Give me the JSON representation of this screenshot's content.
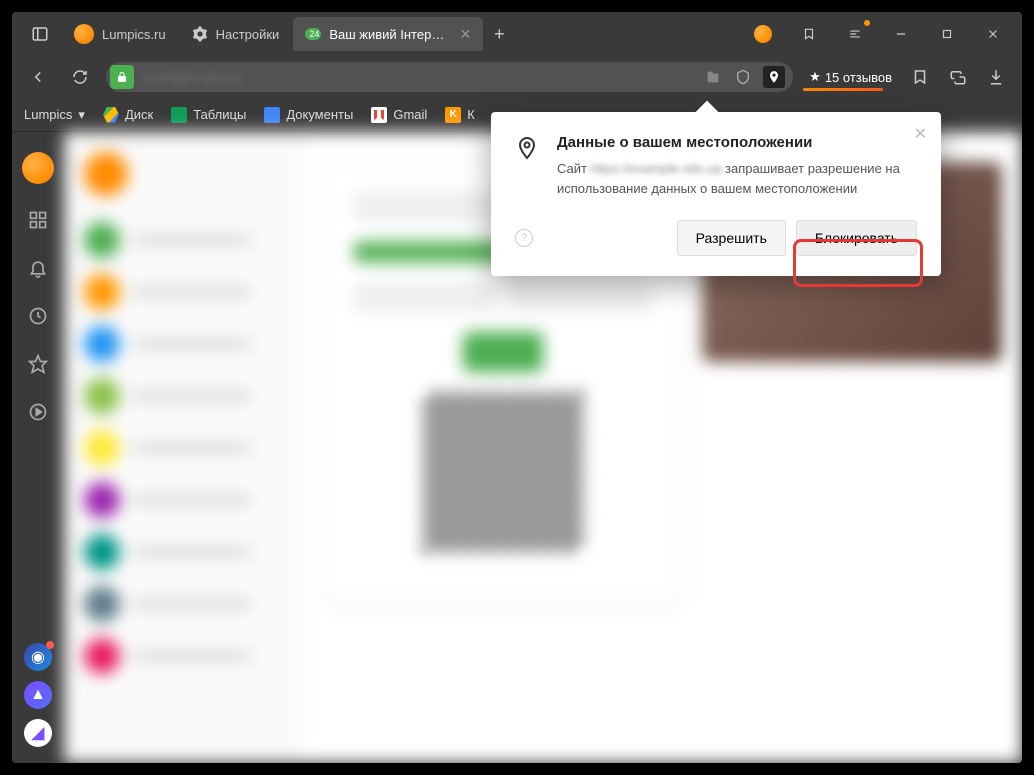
{
  "tabs": [
    {
      "title": "Lumpics.ru",
      "icon": "orange"
    },
    {
      "title": "Настройки",
      "icon": "gear"
    },
    {
      "title": "Ваш живий Інтернет-б",
      "icon": "badge",
      "badge": "24",
      "active": true
    }
  ],
  "addr": {
    "reviews_label": "15 отзывов"
  },
  "bookmarks": {
    "menu": "Lumpics",
    "items": [
      {
        "label": "Диск",
        "icon": "drive"
      },
      {
        "label": "Таблицы",
        "icon": "sheets"
      },
      {
        "label": "Документы",
        "icon": "docs"
      },
      {
        "label": "Gmail",
        "icon": "gmail"
      },
      {
        "label": "К",
        "icon": "k"
      }
    ]
  },
  "popup": {
    "title": "Данные о вашем местоположении",
    "text_prefix": "Сайт ",
    "text_suffix": " запрашивает разрешение на использование данных о вашем местоположении",
    "allow": "Разрешить",
    "block": "Блокировать"
  }
}
